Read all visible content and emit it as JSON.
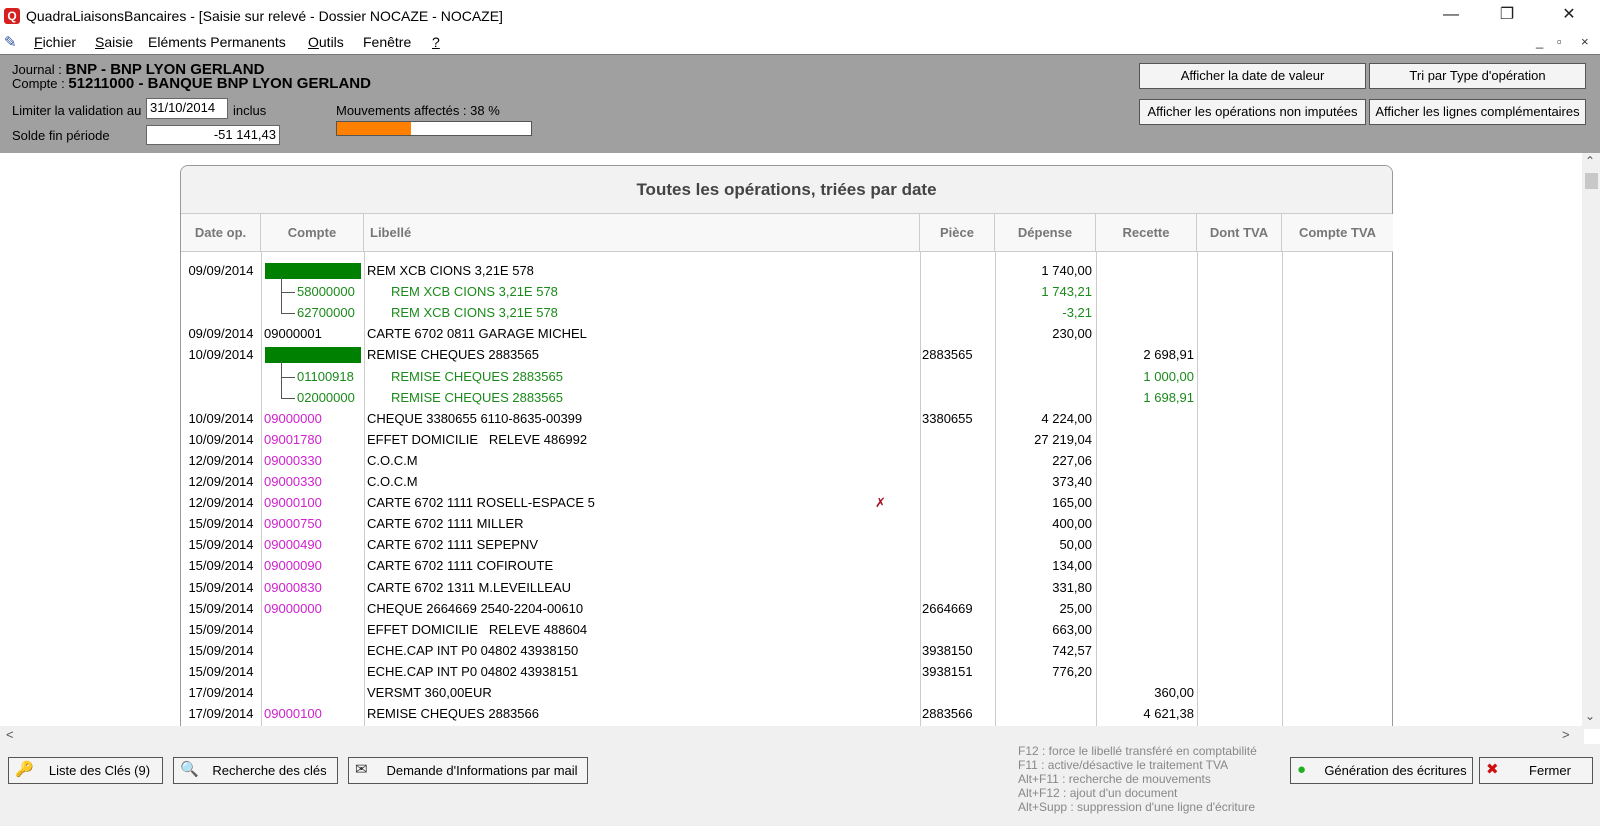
{
  "window": {
    "title": "QuadraLiaisonsBancaires - [Saisie sur relevé - Dossier NOCAZE - NOCAZE]",
    "logo_letter": "Q",
    "minimize": "—",
    "restore": "❐",
    "close": "✕",
    "mdi_min": "_",
    "mdi_restore": "▫",
    "mdi_close": "×"
  },
  "menu": {
    "icon": "✎",
    "items": [
      {
        "u": "F",
        "rest": "ichier"
      },
      {
        "u": "S",
        "rest": "aisie"
      },
      {
        "u": "",
        "rest": "Eléments Permanents"
      },
      {
        "u": "O",
        "rest": "utils"
      },
      {
        "u": "",
        "rest": "Fenêtre"
      },
      {
        "u": "?",
        "rest": ""
      }
    ]
  },
  "header": {
    "journal_label": "Journal : ",
    "journal_value": "BNP - BNP LYON GERLAND",
    "compte_label": "Compte : ",
    "compte_value": "51211000 - BANQUE BNP LYON GERLAND",
    "limit_label": "Limiter la validation au",
    "limit_date": "31/10/2014",
    "limit_suffix": "inclus",
    "solde_label": "Solde fin période",
    "solde_value": "-51 141,43",
    "mouvements_label": "Mouvements affectés : 38 %",
    "progress_percent": 38,
    "buttons": {
      "date_valeur": "Afficher la date de valeur",
      "tri_type": "Tri par Type d'opération",
      "non_imputees": "Afficher les opérations non imputées",
      "lignes_comp": "Afficher les lignes complémentaires"
    }
  },
  "table": {
    "title": "Toutes les opérations, triées par date",
    "columns": [
      "Date op.",
      "Compte",
      "Libellé",
      "Pièce",
      "Dépense",
      "Recette",
      "Dont TVA",
      "Compte TVA"
    ],
    "rows": [
      {
        "kind": "main",
        "date": "09/09/2014",
        "compte": "",
        "bar": true,
        "libelle": "REM XCB CIONS 3,21E 578",
        "piece": "",
        "depense": "1 740,00",
        "recette": ""
      },
      {
        "kind": "sub",
        "compte": "58000000",
        "libelle": "REM XCB CIONS 3,21E 578",
        "depense": "1 743,21",
        "recette": ""
      },
      {
        "kind": "sub-last",
        "compte": "62700000",
        "libelle": "REM XCB CIONS 3,21E 578",
        "depense": "-3,21",
        "recette": ""
      },
      {
        "kind": "main",
        "date": "09/09/2014",
        "compte": "09000001",
        "color": "black",
        "libelle": "CARTE 6702 0811 GARAGE MICHEL",
        "piece": "",
        "depense": "230,00",
        "recette": ""
      },
      {
        "kind": "main",
        "date": "10/09/2014",
        "compte": "",
        "bar": true,
        "libelle": "REMISE CHEQUES 2883565",
        "piece": "2883565",
        "depense": "",
        "recette": "2 698,91"
      },
      {
        "kind": "sub",
        "compte": "01100918",
        "libelle": "REMISE CHEQUES 2883565",
        "depense": "",
        "recette": "1 000,00"
      },
      {
        "kind": "sub-last",
        "compte": "02000000",
        "libelle": "REMISE CHEQUES 2883565",
        "depense": "",
        "recette": "1 698,91"
      },
      {
        "kind": "main",
        "date": "10/09/2014",
        "compte": "09000000",
        "color": "pink",
        "libelle": "CHEQUE 3380655 6110-8635-00399",
        "piece": "3380655",
        "depense": "4 224,00",
        "recette": ""
      },
      {
        "kind": "main",
        "date": "10/09/2014",
        "compte": "09001780",
        "color": "pink",
        "libelle": "EFFET DOMICILIE   RELEVE 486992",
        "piece": "",
        "depense": "27 219,04",
        "recette": ""
      },
      {
        "kind": "main",
        "date": "12/09/2014",
        "compte": "09000330",
        "color": "pink",
        "libelle": "C.O.C.M",
        "piece": "",
        "depense": "227,06",
        "recette": ""
      },
      {
        "kind": "main",
        "date": "12/09/2014",
        "compte": "09000330",
        "color": "pink",
        "libelle": "C.O.C.M",
        "piece": "",
        "depense": "373,40",
        "recette": ""
      },
      {
        "kind": "main",
        "date": "12/09/2014",
        "compte": "09000100",
        "color": "pink",
        "libelle": "CARTE 6702 1111 ROSELL-ESPACE 5",
        "mark": "✗",
        "piece": "",
        "depense": "165,00",
        "recette": ""
      },
      {
        "kind": "main",
        "date": "15/09/2014",
        "compte": "09000750",
        "color": "pink",
        "libelle": "CARTE 6702 1111 MILLER",
        "piece": "",
        "depense": "400,00",
        "recette": ""
      },
      {
        "kind": "main",
        "date": "15/09/2014",
        "compte": "09000490",
        "color": "pink",
        "libelle": "CARTE 6702 1111 SEPEPNV",
        "piece": "",
        "depense": "50,00",
        "recette": ""
      },
      {
        "kind": "main",
        "date": "15/09/2014",
        "compte": "09000090",
        "color": "pink",
        "libelle": "CARTE 6702 1111 COFIROUTE",
        "piece": "",
        "depense": "134,00",
        "recette": ""
      },
      {
        "kind": "main",
        "date": "15/09/2014",
        "compte": "09000830",
        "color": "pink",
        "libelle": "CARTE 6702 1311 M.LEVEILLEAU",
        "piece": "",
        "depense": "331,80",
        "recette": ""
      },
      {
        "kind": "main",
        "date": "15/09/2014",
        "compte": "09000000",
        "color": "pink",
        "libelle": "CHEQUE 2664669 2540-2204-00610",
        "piece": "2664669",
        "depense": "25,00",
        "recette": ""
      },
      {
        "kind": "main",
        "date": "15/09/2014",
        "compte": "",
        "libelle": "EFFET DOMICILIE   RELEVE 488604",
        "piece": "",
        "depense": "663,00",
        "recette": ""
      },
      {
        "kind": "main",
        "date": "15/09/2014",
        "compte": "",
        "libelle": "ECHE.CAP INT P0 04802 43938150",
        "piece": "3938150",
        "depense": "742,57",
        "recette": ""
      },
      {
        "kind": "main",
        "date": "15/09/2014",
        "compte": "",
        "libelle": "ECHE.CAP INT P0 04802 43938151",
        "piece": "3938151",
        "depense": "776,20",
        "recette": ""
      },
      {
        "kind": "main",
        "date": "17/09/2014",
        "compte": "",
        "libelle": "VERSMT 360,00EUR",
        "piece": "",
        "depense": "",
        "recette": "360,00"
      },
      {
        "kind": "main",
        "date": "17/09/2014",
        "compte": "09000100",
        "color": "pink",
        "libelle": "REMISE CHEQUES 2883566",
        "piece": "2883566",
        "depense": "",
        "recette": "4 621,38"
      }
    ]
  },
  "scroll": {
    "up": "⌃",
    "down": "⌄",
    "left": "<",
    "right": ">"
  },
  "bottom": {
    "liste_cles": "Liste des Clés (9)",
    "recherche_cles": "Recherche des clés",
    "demande_info": "Demande d'Informations par mail",
    "generation": "Génération des écritures",
    "fermer": "Fermer",
    "help": [
      "F12 : force le libellé transféré en comptabilité",
      "F11 : active/désactive le traitement TVA",
      "Alt+F11 : recherche de mouvements",
      "Alt+F12 : ajout d'un document",
      "Alt+Supp : suppression d'une ligne d'écriture"
    ],
    "icons": {
      "key": "🔑",
      "search": "🔍",
      "mail": "✉",
      "go": "●",
      "close": "✖"
    }
  }
}
